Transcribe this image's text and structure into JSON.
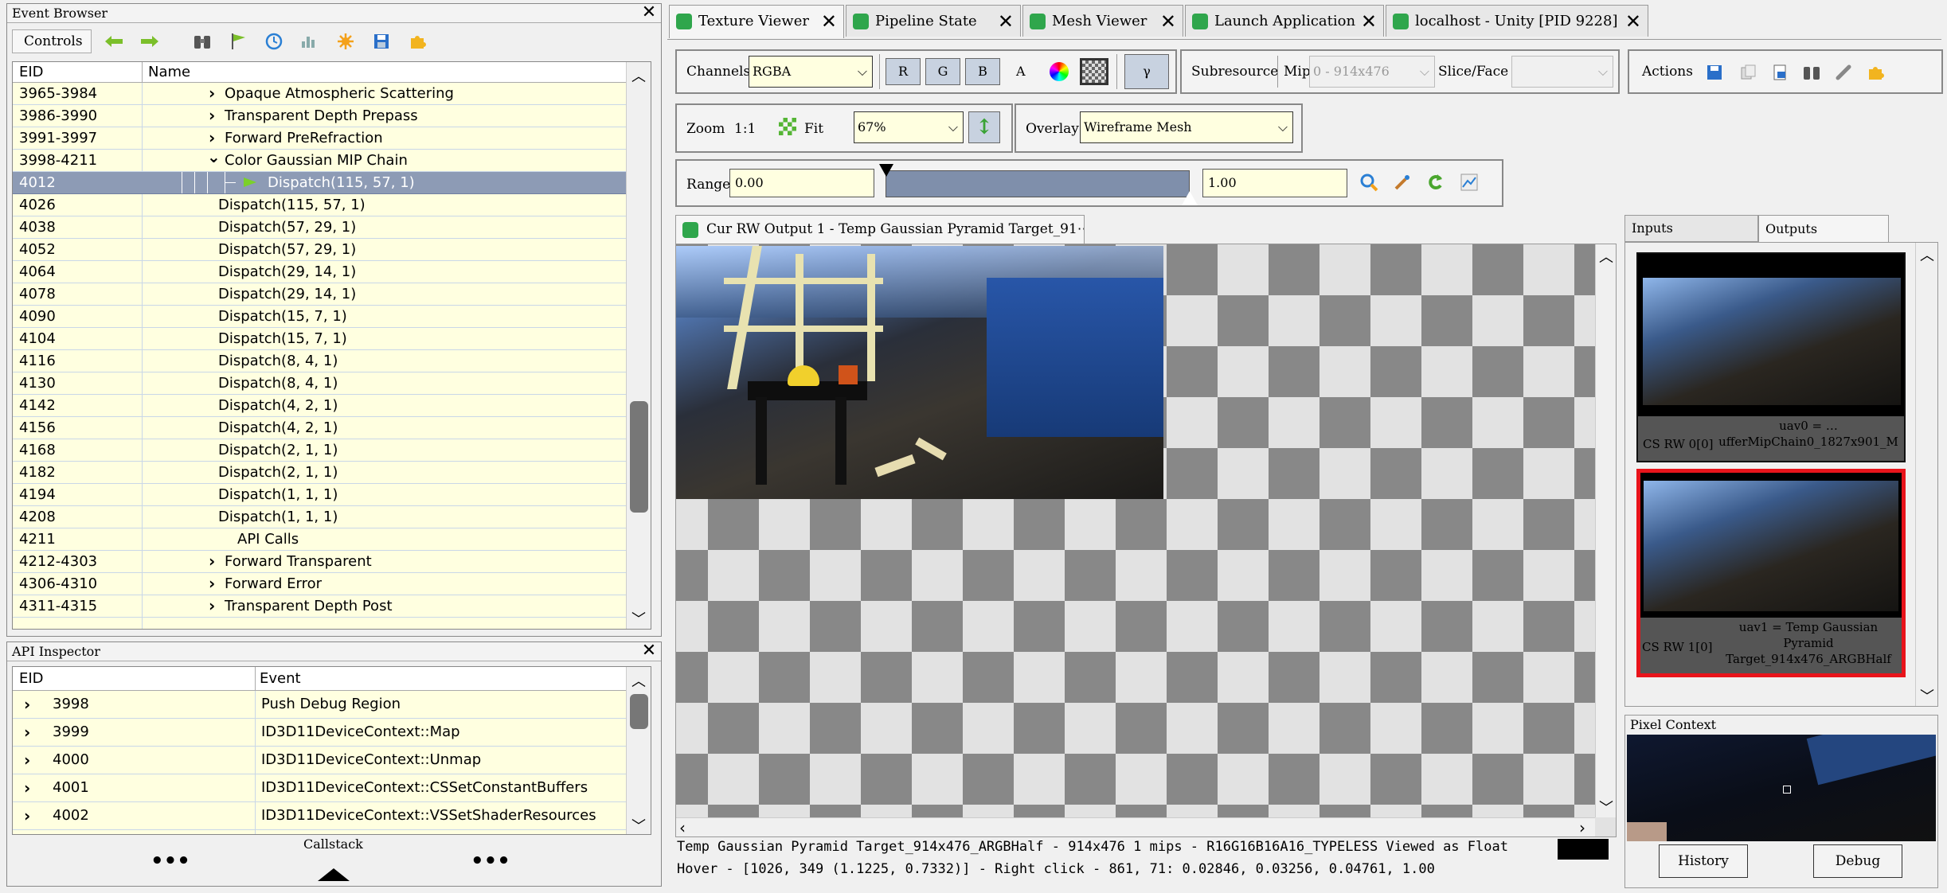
{
  "event_browser": {
    "title": "Event Browser",
    "controls_label": "Controls",
    "col_eid": "EID",
    "col_name": "Name",
    "rows": [
      {
        "eid": "3965-3984",
        "name": "Opaque Atmospheric Scattering"
      },
      {
        "eid": "3986-3990",
        "name": "Transparent Depth Prepass"
      },
      {
        "eid": "3991-3997",
        "name": "Forward PreRefraction"
      },
      {
        "eid": "3998-4211",
        "name": "Color Gaussian MIP Chain"
      },
      {
        "eid": "4012",
        "name": "Dispatch(115, 57, 1)"
      },
      {
        "eid": "4026",
        "name": "Dispatch(115, 57, 1)"
      },
      {
        "eid": "4038",
        "name": "Dispatch(57, 29, 1)"
      },
      {
        "eid": "4052",
        "name": "Dispatch(57, 29, 1)"
      },
      {
        "eid": "4064",
        "name": "Dispatch(29, 14, 1)"
      },
      {
        "eid": "4078",
        "name": "Dispatch(29, 14, 1)"
      },
      {
        "eid": "4090",
        "name": "Dispatch(15, 7, 1)"
      },
      {
        "eid": "4104",
        "name": "Dispatch(15, 7, 1)"
      },
      {
        "eid": "4116",
        "name": "Dispatch(8, 4, 1)"
      },
      {
        "eid": "4130",
        "name": "Dispatch(8, 4, 1)"
      },
      {
        "eid": "4142",
        "name": "Dispatch(4, 2, 1)"
      },
      {
        "eid": "4156",
        "name": "Dispatch(4, 2, 1)"
      },
      {
        "eid": "4168",
        "name": "Dispatch(2, 1, 1)"
      },
      {
        "eid": "4182",
        "name": "Dispatch(2, 1, 1)"
      },
      {
        "eid": "4194",
        "name": "Dispatch(1, 1, 1)"
      },
      {
        "eid": "4208",
        "name": "Dispatch(1, 1, 1)"
      },
      {
        "eid": "4211",
        "name": "API Calls"
      },
      {
        "eid": "4212-4303",
        "name": "Forward Transparent"
      },
      {
        "eid": "4306-4310",
        "name": "Forward Error"
      },
      {
        "eid": "4311-4315",
        "name": "Transparent Depth Post"
      }
    ]
  },
  "api_inspector": {
    "title": "API Inspector",
    "col_eid": "EID",
    "col_event": "Event",
    "rows": [
      {
        "eid": "3998",
        "event": "Push Debug Region"
      },
      {
        "eid": "3999",
        "event": "ID3D11DeviceContext::Map"
      },
      {
        "eid": "4000",
        "event": "ID3D11DeviceContext::Unmap"
      },
      {
        "eid": "4001",
        "event": "ID3D11DeviceContext::CSSetConstantBuffers"
      },
      {
        "eid": "4002",
        "event": "ID3D11DeviceContext::VSSetShaderResources"
      }
    ],
    "callstack_label": "Callstack",
    "dots": "•••"
  },
  "tabs": [
    {
      "label": "Texture Viewer"
    },
    {
      "label": "Pipeline State"
    },
    {
      "label": "Mesh Viewer"
    },
    {
      "label": "Launch Application"
    },
    {
      "label": "localhost - Unity [PID 9228]"
    }
  ],
  "toolbar": {
    "channels_label": "Channels",
    "channels_value": "RGBA",
    "r": "R",
    "g": "G",
    "b": "B",
    "a": "A",
    "gamma": "γ",
    "subresource_label": "Subresource",
    "mip_label": "Mip",
    "mip_value": "0 - 914x476",
    "slice_label": "Slice/Face",
    "actions_label": "Actions",
    "zoom_label": "Zoom",
    "zoom_1to1": "1:1",
    "fit_label": "Fit",
    "zoom_value": "67%",
    "overlay_label": "Overlay",
    "overlay_value": "Wireframe Mesh",
    "range_label": "Range",
    "range_min": "0.00",
    "range_max": "1.00"
  },
  "viewer": {
    "tab_label": "Cur RW Output 1 - Temp Gaussian Pyramid Target_91⋯",
    "status_line1": "Temp Gaussian Pyramid Target_914x476_ARGBHalf - 914x476 1 mips - R16G16B16A16_TYPELESS Viewed as Float",
    "status_line2": "Hover - [1026,  349 (1.1225, 0.7332)] - Right click -  861,   71: 0.02846, 0.03256, 0.04761, 1.00"
  },
  "thumbs": {
    "inputs_tab": "Inputs",
    "outputs_tab": "Outputs",
    "items": [
      {
        "slot": "CS RW 0[0]",
        "name": "uav0 = …ufferMipChain0_1827x901_M"
      },
      {
        "slot": "CS RW 1[0]",
        "name": "uav1 = Temp Gaussian Pyramid Target_914x476_ARGBHalf"
      }
    ]
  },
  "pixel_context": {
    "title": "Pixel Context",
    "history_button": "History",
    "debug_button": "Debug"
  }
}
